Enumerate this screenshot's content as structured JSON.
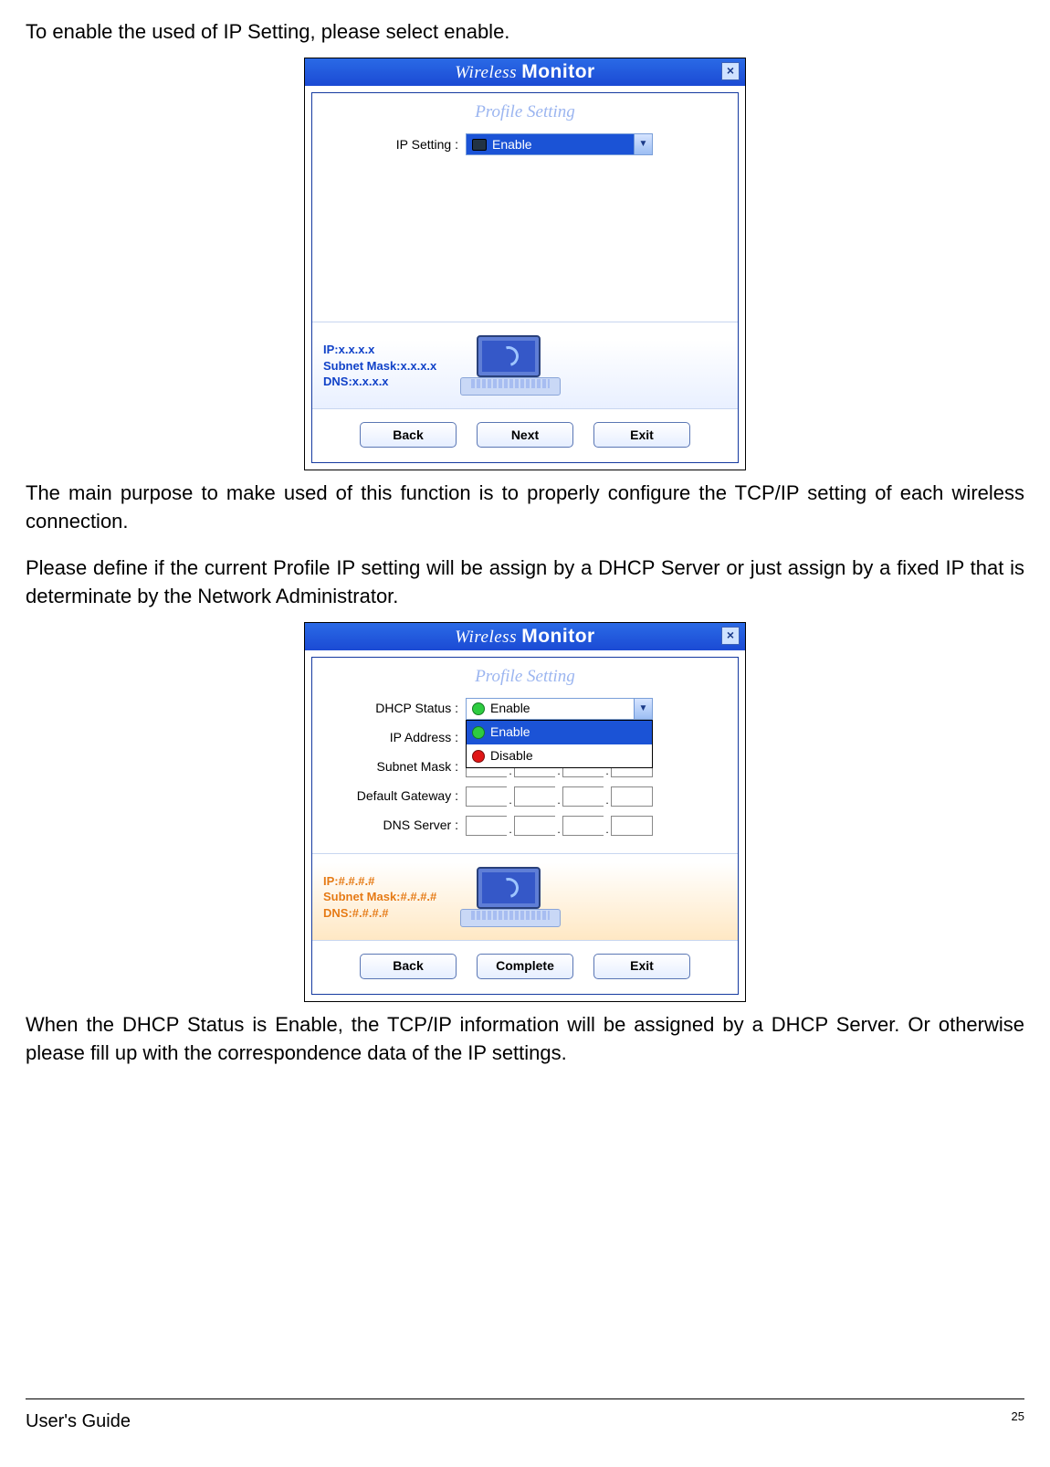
{
  "para1": "To enable the used of IP Setting, please select enable.",
  "para2": "The main purpose to make used of this function is to properly configure the TCP/IP setting of each wireless connection.",
  "para3": "Please define if the current Profile IP setting will be assign by a DHCP Server or just assign by a fixed IP that is determinate by the Network Administrator.",
  "para4": "When the DHCP Status is Enable, the TCP/IP information will be assigned by a DHCP Server. Or otherwise please fill up with the correspondence data of the IP settings.",
  "dialog": {
    "title_prefix": "Wireless",
    "title_suffix": "Monitor",
    "subtitle": "Profile Setting",
    "close": "×"
  },
  "dlg1": {
    "ip_setting_label": "IP Setting :",
    "ip_setting_value": "Enable",
    "info_ip": "IP:x.x.x.x",
    "info_mask": "Subnet Mask:x.x.x.x",
    "info_dns": "DNS:x.x.x.x",
    "btn_back": "Back",
    "btn_next": "Next",
    "btn_exit": "Exit"
  },
  "dlg2": {
    "dhcp_label": "DHCP Status :",
    "ip_label": "IP Address :",
    "mask_label": "Subnet Mask :",
    "gw_label": "Default Gateway :",
    "dns_label": "DNS Server :",
    "dhcp_value": "Enable",
    "opt_enable": "Enable",
    "opt_disable": "Disable",
    "info_ip": "IP:#.#.#.#",
    "info_mask": "Subnet Mask:#.#.#.#",
    "info_dns": "DNS:#.#.#.#",
    "btn_back": "Back",
    "btn_complete": "Complete",
    "btn_exit": "Exit"
  },
  "footer": {
    "left": "User's Guide",
    "page": "25"
  }
}
